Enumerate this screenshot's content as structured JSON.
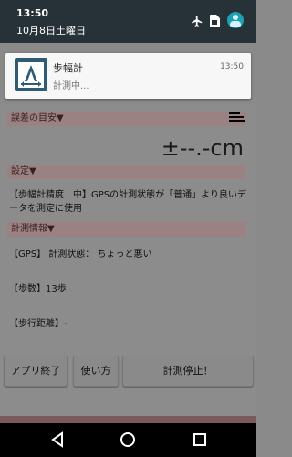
{
  "shade": {
    "time": "13:50",
    "date": "10月8日土曜日",
    "icons": [
      "airplane-icon",
      "sim-icon",
      "account-avatar-icon"
    ]
  },
  "notification": {
    "app_name": "歩幅計",
    "text": "計測中...",
    "time": "13:50",
    "icon": "app-stride-icon"
  },
  "app": {
    "error_margin_header": "誤差の目安▼",
    "error_value": "±--.-cm",
    "settings_header": "設定▼",
    "settings_text": "【歩幅計精度　中】GPSの計測状態が「普通」より良いデータを測定に使用",
    "measure_header": "計測情報▼",
    "gps_line": "【GPS】 計測状態：  ちょっと悪い",
    "steps_line": "【歩数】13歩",
    "distance_line": "【歩行距離】-",
    "buttons": {
      "exit": "アプリ終了",
      "howto": "使い方",
      "stop": "計測停止！"
    }
  },
  "navbar": {
    "icons": [
      "back-icon",
      "home-icon",
      "recents-icon"
    ]
  }
}
